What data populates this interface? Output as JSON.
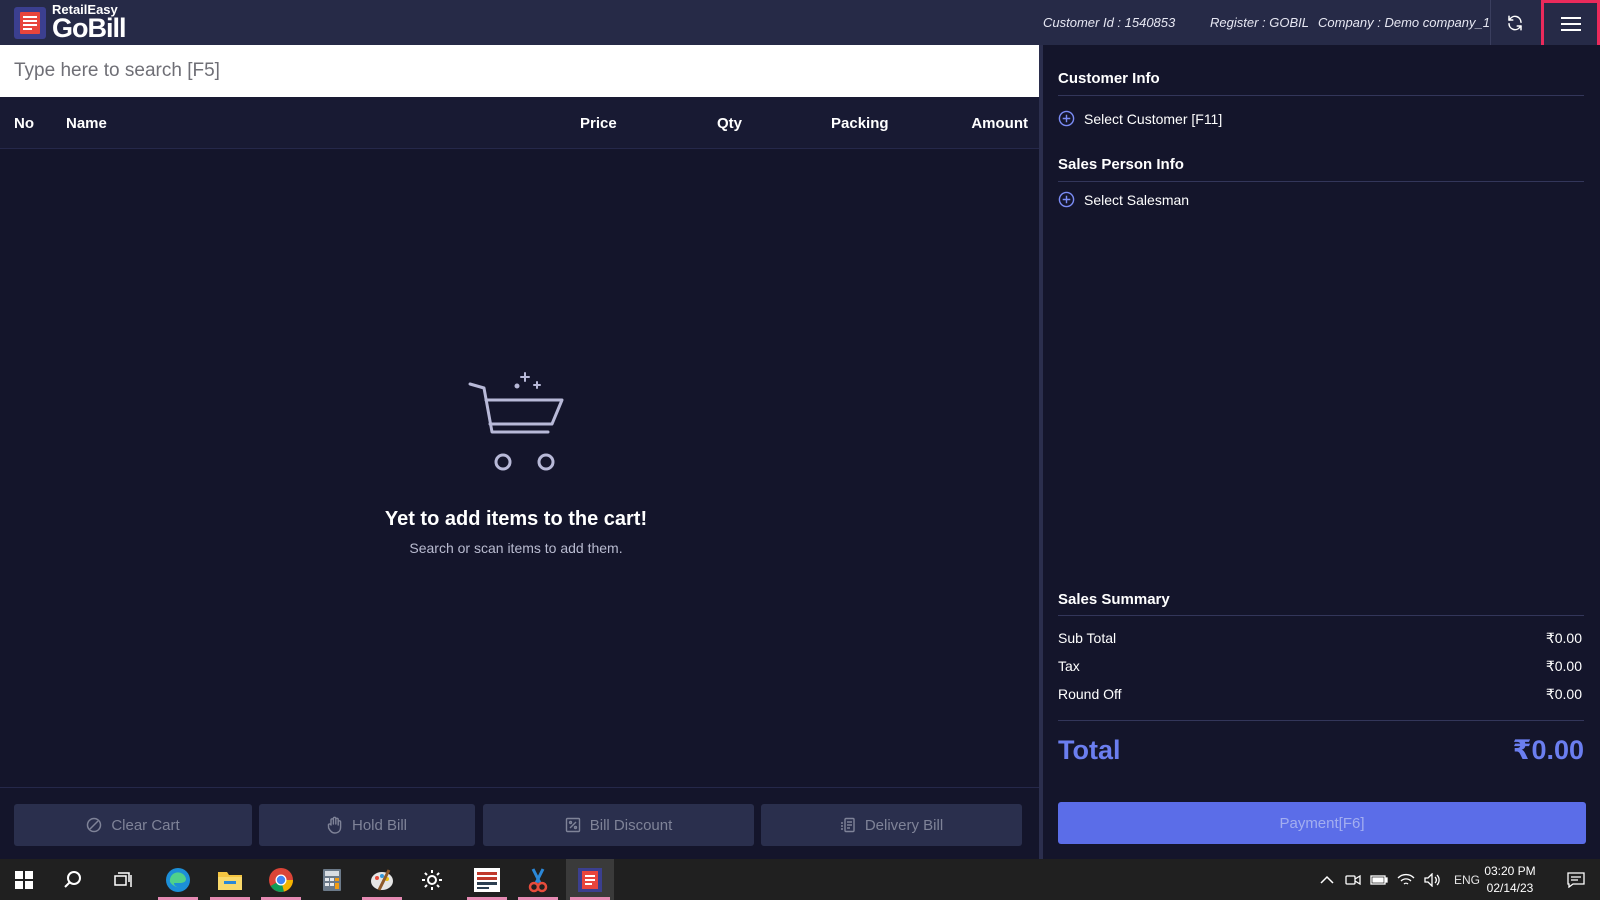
{
  "app": {
    "brand_small": "RetailEasy",
    "brand_big": "GoBill",
    "customer_id": "Customer Id : 1540853",
    "register": "Register : GOBIL",
    "company": "Company : Demo company_1"
  },
  "colors": {
    "background": "#14152b",
    "topbar": "#262a47",
    "accent": "#5b6de8",
    "total_text": "#6b7ef0",
    "highlight_border": "#ea2a5b"
  },
  "search": {
    "placeholder": "Type here to search [F5]",
    "value": ""
  },
  "cart_table": {
    "columns": [
      "No",
      "Name",
      "Price",
      "Qty",
      "Packing",
      "Amount"
    ],
    "rows": []
  },
  "empty_state": {
    "title": "Yet to add items to the cart!",
    "subtitle": "Search or scan items to add them."
  },
  "actions": {
    "clear_cart": "Clear Cart",
    "hold_bill": "Hold Bill",
    "bill_discount": "Bill Discount",
    "delivery_bill": "Delivery Bill"
  },
  "customer_info": {
    "title": "Customer Info",
    "select_label": "Select Customer [F11]"
  },
  "sales_person_info": {
    "title": "Sales Person Info",
    "select_label": "Select Salesman"
  },
  "sales_summary": {
    "title": "Sales Summary",
    "rows": [
      {
        "label": "Sub Total",
        "value": "₹0.00"
      },
      {
        "label": "Tax",
        "value": "₹0.00"
      },
      {
        "label": "Round Off",
        "value": "₹0.00"
      }
    ],
    "total_label": "Total",
    "total_value": "₹0.00"
  },
  "payment": {
    "label": "Payment[F6]"
  },
  "taskbar": {
    "apps": [
      "start-icon",
      "search-icon",
      "task-view-icon",
      "edge-icon",
      "file-explorer-icon",
      "chrome-icon",
      "calculator-icon",
      "paint-icon",
      "settings-icon",
      "retaileasy-icon",
      "snipping-tool-icon",
      "gobill-icon"
    ],
    "language": "ENG",
    "time": "03:20 PM",
    "date": "02/14/23"
  }
}
